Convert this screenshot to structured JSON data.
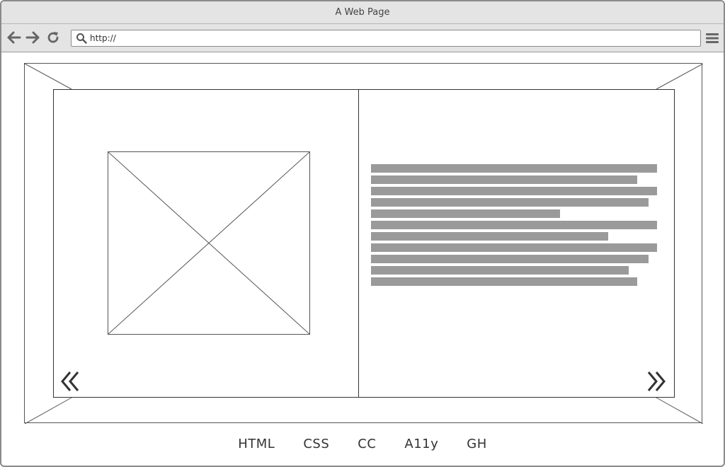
{
  "window": {
    "title": "A Web Page"
  },
  "toolbar": {
    "back_icon": "arrow-left-icon",
    "forward_icon": "arrow-right-icon",
    "reload_icon": "reload-icon",
    "menu_icon": "hamburger-menu-icon",
    "search_icon": "search-icon",
    "address_value": "http://"
  },
  "carousel": {
    "image_placeholder": "image-placeholder",
    "text_lines": [
      1.0,
      0.93,
      1.0,
      0.97,
      0.66,
      1.0,
      0.83,
      1.0,
      0.97,
      0.9,
      0.93
    ],
    "prev_icon": "double-chevron-left-icon",
    "next_icon": "double-chevron-right-icon"
  },
  "footer": {
    "links": [
      "HTML",
      "CSS",
      "CC",
      "A11y",
      "GH"
    ]
  },
  "colors": {
    "chrome": "#e4e4e4",
    "border": "#8a8a8a",
    "text_placeholder": "#9a9a9a",
    "line": "#333333"
  }
}
